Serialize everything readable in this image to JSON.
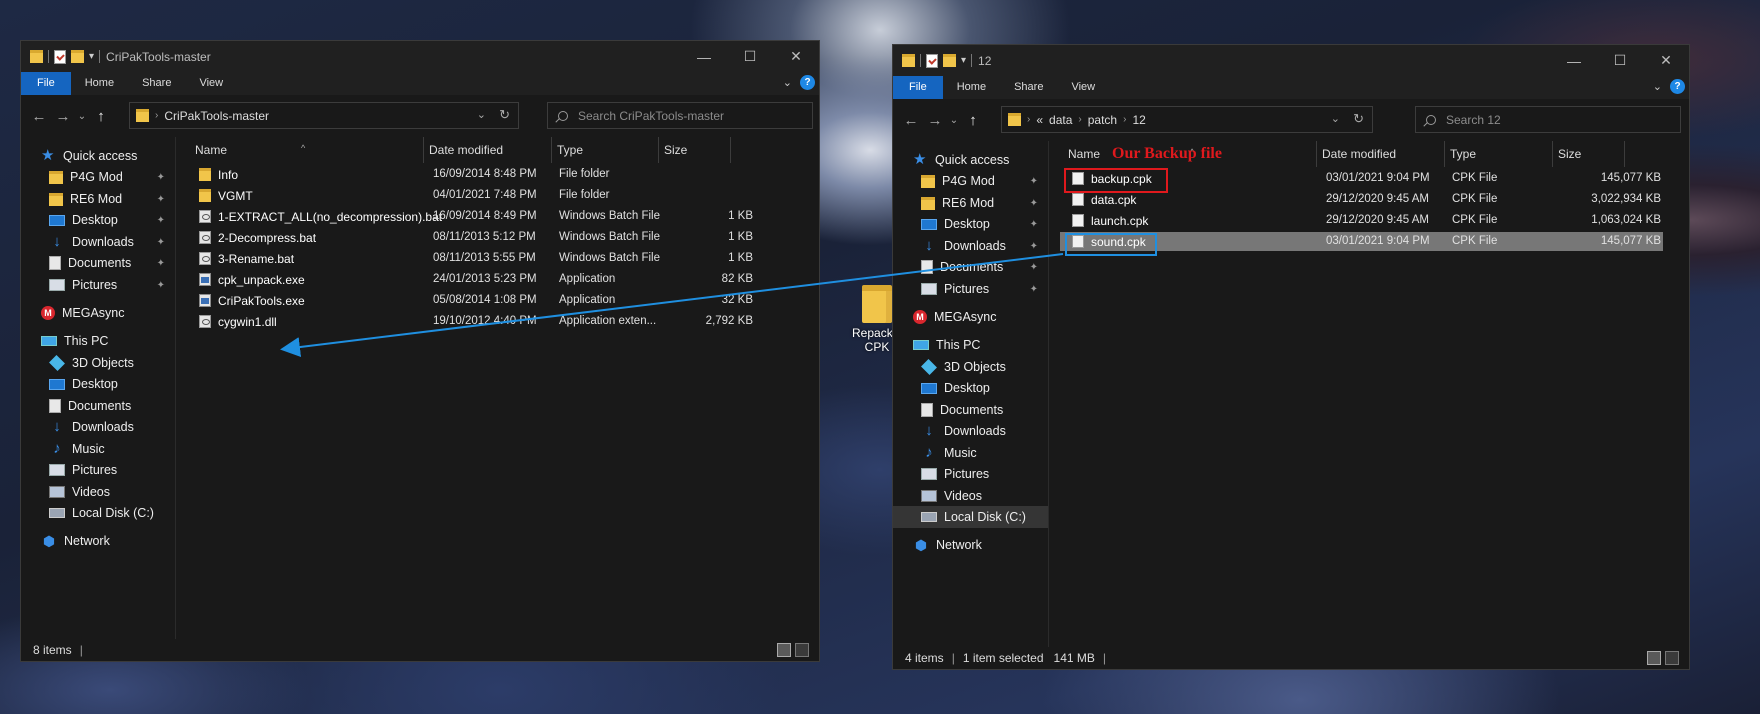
{
  "left_window": {
    "title": "CriPakTools-master",
    "ribbon_tabs": [
      "File",
      "Home",
      "Share",
      "View"
    ],
    "address": [
      "CriPakTools-master"
    ],
    "search_placeholder": "Search CriPakTools-master",
    "columns": {
      "name": "Name",
      "date": "Date modified",
      "type": "Type",
      "size": "Size"
    },
    "sidebar": [
      {
        "label": "Quick access",
        "icon": "star-icon"
      },
      {
        "label": "P4G Mod",
        "icon": "folder-icon",
        "pinned": true
      },
      {
        "label": "RE6 Mod",
        "icon": "folder-icon",
        "pinned": true
      },
      {
        "label": "Desktop",
        "icon": "desktop-icon",
        "pinned": true
      },
      {
        "label": "Downloads",
        "icon": "downloads-icon",
        "pinned": true
      },
      {
        "label": "Documents",
        "icon": "documents-icon",
        "pinned": true
      },
      {
        "label": "Pictures",
        "icon": "pictures-icon",
        "pinned": true
      },
      {
        "label": "MEGAsync",
        "icon": "mega-icon"
      },
      {
        "label": "This PC",
        "icon": "pc-icon"
      },
      {
        "label": "3D Objects",
        "icon": "3d-objects-icon"
      },
      {
        "label": "Desktop",
        "icon": "desktop-icon"
      },
      {
        "label": "Documents",
        "icon": "documents-icon"
      },
      {
        "label": "Downloads",
        "icon": "downloads-icon"
      },
      {
        "label": "Music",
        "icon": "music-icon"
      },
      {
        "label": "Pictures",
        "icon": "pictures-icon"
      },
      {
        "label": "Videos",
        "icon": "videos-icon"
      },
      {
        "label": "Local Disk (C:)",
        "icon": "disk-icon"
      },
      {
        "label": "Network",
        "icon": "network-icon"
      }
    ],
    "files": [
      {
        "name": "Info",
        "date": "16/09/2014 8:48 PM",
        "type": "File folder",
        "size": "",
        "icon": "folder"
      },
      {
        "name": "VGMT",
        "date": "04/01/2021 7:48 PM",
        "type": "File folder",
        "size": "",
        "icon": "folder"
      },
      {
        "name": "1-EXTRACT_ALL(no_decompression).bat",
        "date": "16/09/2014 8:49 PM",
        "type": "Windows Batch File",
        "size": "1 KB",
        "icon": "bat"
      },
      {
        "name": "2-Decompress.bat",
        "date": "08/11/2013 5:12 PM",
        "type": "Windows Batch File",
        "size": "1 KB",
        "icon": "bat"
      },
      {
        "name": "3-Rename.bat",
        "date": "08/11/2013 5:55 PM",
        "type": "Windows Batch File",
        "size": "1 KB",
        "icon": "bat"
      },
      {
        "name": "cpk_unpack.exe",
        "date": "24/01/2013 5:23 PM",
        "type": "Application",
        "size": "82 KB",
        "icon": "exe"
      },
      {
        "name": "CriPakTools.exe",
        "date": "05/08/2014 1:08 PM",
        "type": "Application",
        "size": "32 KB",
        "icon": "exe"
      },
      {
        "name": "cygwin1.dll",
        "date": "19/10/2012 4:40 PM",
        "type": "Application exten...",
        "size": "2,792 KB",
        "icon": "bat"
      }
    ],
    "status": {
      "items": "8 items"
    }
  },
  "right_window": {
    "title": "12",
    "ribbon_tabs": [
      "File",
      "Home",
      "Share",
      "View"
    ],
    "address": [
      "«",
      "data",
      "patch",
      "12"
    ],
    "search_placeholder": "Search 12",
    "columns": {
      "name": "Name",
      "date": "Date modified",
      "type": "Type",
      "size": "Size"
    },
    "sidebar": [
      {
        "label": "Quick access",
        "icon": "star-icon"
      },
      {
        "label": "P4G Mod",
        "icon": "folder-icon",
        "pinned": true
      },
      {
        "label": "RE6 Mod",
        "icon": "folder-icon",
        "pinned": true
      },
      {
        "label": "Desktop",
        "icon": "desktop-icon",
        "pinned": true
      },
      {
        "label": "Downloads",
        "icon": "downloads-icon",
        "pinned": true
      },
      {
        "label": "Documents",
        "icon": "documents-icon",
        "pinned": true
      },
      {
        "label": "Pictures",
        "icon": "pictures-icon",
        "pinned": true
      },
      {
        "label": "MEGAsync",
        "icon": "mega-icon"
      },
      {
        "label": "This PC",
        "icon": "pc-icon"
      },
      {
        "label": "3D Objects",
        "icon": "3d-objects-icon"
      },
      {
        "label": "Desktop",
        "icon": "desktop-icon"
      },
      {
        "label": "Documents",
        "icon": "documents-icon"
      },
      {
        "label": "Downloads",
        "icon": "downloads-icon"
      },
      {
        "label": "Music",
        "icon": "music-icon"
      },
      {
        "label": "Pictures",
        "icon": "pictures-icon"
      },
      {
        "label": "Videos",
        "icon": "videos-icon"
      },
      {
        "label": "Local Disk (C:)",
        "icon": "disk-icon",
        "selected": true
      },
      {
        "label": "Network",
        "icon": "network-icon"
      }
    ],
    "files": [
      {
        "name": "backup.cpk",
        "date": "03/01/2021 9:04 PM",
        "type": "CPK File",
        "size": "145,077 KB",
        "icon": "cpk"
      },
      {
        "name": "data.cpk",
        "date": "29/12/2020 9:45 AM",
        "type": "CPK File",
        "size": "3,022,934 KB",
        "icon": "cpk"
      },
      {
        "name": "launch.cpk",
        "date": "29/12/2020 9:45 AM",
        "type": "CPK File",
        "size": "1,063,024 KB",
        "icon": "cpk"
      },
      {
        "name": "sound.cpk",
        "date": "03/01/2021 9:04 PM",
        "type": "CPK File",
        "size": "145,077 KB",
        "icon": "cpk",
        "selected": true
      }
    ],
    "status": {
      "items": "4 items",
      "selected": "1 item selected",
      "size": "141 MB"
    }
  },
  "desktop_icon": {
    "label": "Repacked CPK"
  },
  "annotation": {
    "text": "Our Backup file",
    "color": "#e0191d",
    "arrow_color": "#1f8fe0"
  },
  "colors": {
    "accent": "#1565c0",
    "background": "#191919",
    "selection": "#777777"
  }
}
